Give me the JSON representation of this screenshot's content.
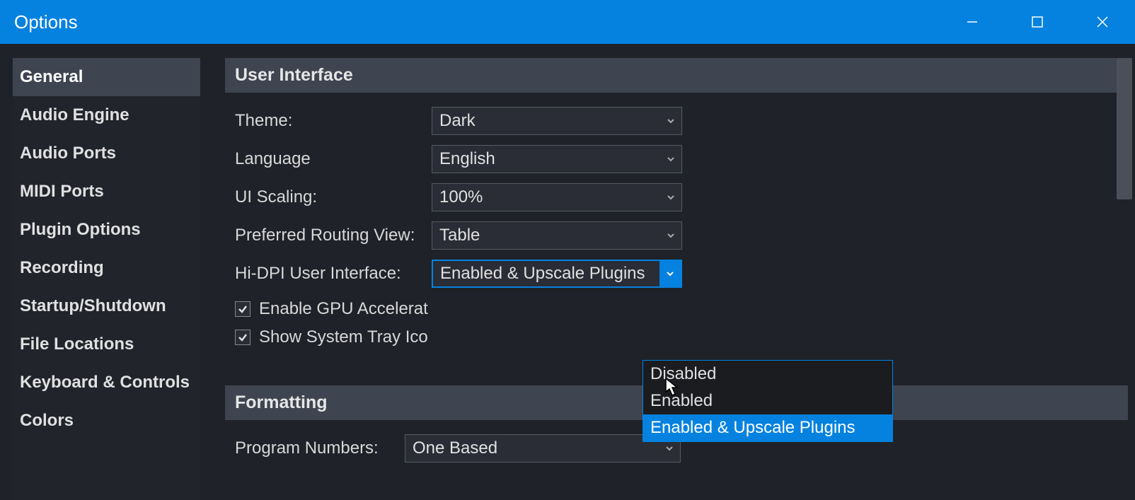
{
  "window": {
    "title": "Options"
  },
  "sidebar": {
    "items": [
      {
        "label": "General",
        "active": true
      },
      {
        "label": "Audio Engine",
        "active": false
      },
      {
        "label": "Audio Ports",
        "active": false
      },
      {
        "label": "MIDI Ports",
        "active": false
      },
      {
        "label": "Plugin Options",
        "active": false
      },
      {
        "label": "Recording",
        "active": false
      },
      {
        "label": "Startup/Shutdown",
        "active": false
      },
      {
        "label": "File Locations",
        "active": false
      },
      {
        "label": "Keyboard & Controls",
        "active": false
      },
      {
        "label": "Colors",
        "active": false
      }
    ]
  },
  "sections": {
    "ui": {
      "header": "User Interface",
      "theme": {
        "label": "Theme:",
        "value": "Dark"
      },
      "language": {
        "label": "Language",
        "value": "English"
      },
      "scaling": {
        "label": "UI Scaling:",
        "value": "100%"
      },
      "routing_view": {
        "label": "Preferred Routing View:",
        "value": "Table"
      },
      "hidpi": {
        "label": "Hi-DPI User Interface:",
        "value": "Enabled & Upscale Plugins",
        "options": [
          "Disabled",
          "Enabled",
          "Enabled & Upscale Plugins"
        ]
      },
      "gpu_accel": {
        "label": "Enable GPU Accelerat",
        "checked": true
      },
      "tray_icon": {
        "label": "Show System Tray Ico",
        "checked": true
      }
    },
    "formatting": {
      "header": "Formatting",
      "program_numbers": {
        "label": "Program Numbers:",
        "value": "One Based"
      }
    }
  }
}
